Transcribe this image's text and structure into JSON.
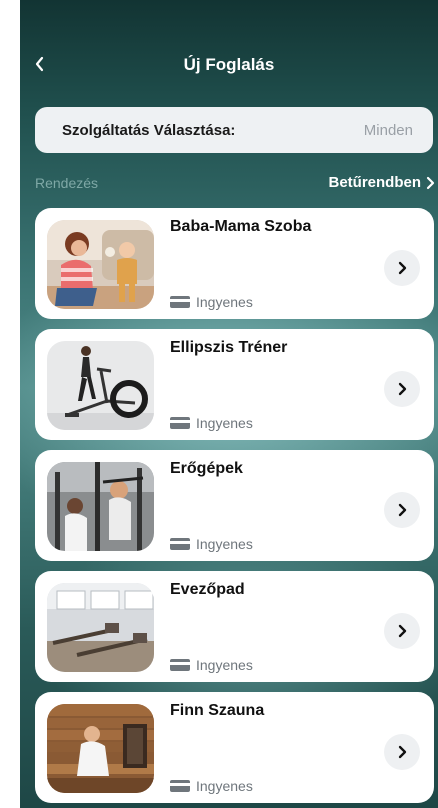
{
  "header": {
    "title": "Új Foglalás",
    "back_icon": "chevron-left-icon"
  },
  "service": {
    "label": "Szolgáltatás Választása:",
    "value": "Minden"
  },
  "sort": {
    "label": "Rendezés",
    "value": "Betűrendben",
    "icon": "chevron-right-icon"
  },
  "services": [
    {
      "name": "Baba-Mama Szoba",
      "price": "Ingyenes",
      "image": "mother-baby-photo"
    },
    {
      "name": "Ellipszis Tréner",
      "price": "Ingyenes",
      "image": "elliptical-trainer-photo"
    },
    {
      "name": "Erőgépek",
      "price": "Ingyenes",
      "image": "strength-machines-photo"
    },
    {
      "name": "Evezőpad",
      "price": "Ingyenes",
      "image": "rowing-machine-room-photo"
    },
    {
      "name": "Finn Szauna",
      "price": "Ingyenes",
      "image": "finnish-sauna-photo"
    }
  ],
  "colors": {
    "accent_text": "#ffffff",
    "muted_label": "#7fa8a6",
    "card_bg": "#ffffff"
  }
}
